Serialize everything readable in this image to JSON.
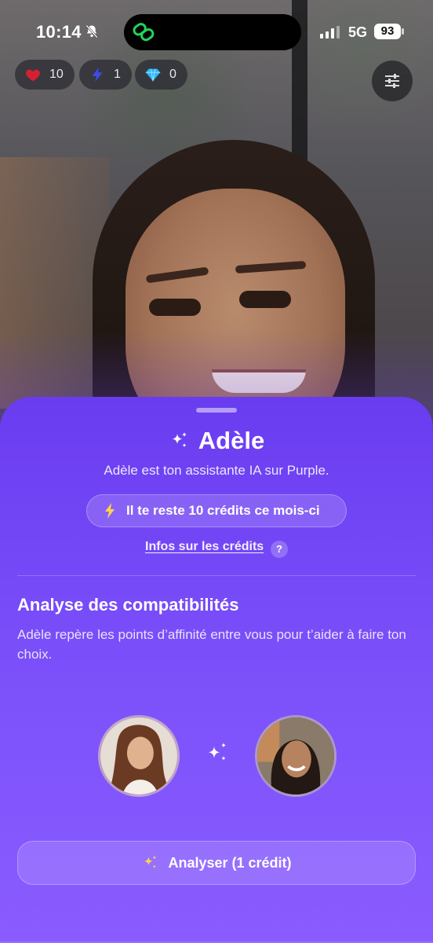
{
  "status_bar": {
    "time": "10:14",
    "network": "5G",
    "battery": "93"
  },
  "stats": {
    "likes": "10",
    "boosts": "1",
    "gems": "0"
  },
  "sheet": {
    "title": "Adèle",
    "subtitle": "Adèle est ton assistante IA sur Purple.",
    "credits_text": "Il te reste 10 crédits ce mois-ci",
    "info_link": "Infos sur les crédits",
    "help_label": "?",
    "section_title": "Analyse des compatibilités",
    "section_desc": "Adèle repère les points d’affinité entre vous pour t’aider à faire ton choix.",
    "analyze_label": "Analyser (1 crédit)"
  },
  "colors": {
    "sheet_top": "#6a3cf0",
    "sheet_bottom": "#8a5cff",
    "accent_yellow": "#ffd24a",
    "heart": "#d6202f",
    "bolt": "#3a4cf0",
    "gem": "#2fb6ff"
  },
  "icons": {
    "bell": "bell-slash-icon",
    "logo": "purple-logo-icon",
    "filter": "sliders-icon",
    "sparkles": "sparkles-icon",
    "bolt": "bolt-icon"
  }
}
